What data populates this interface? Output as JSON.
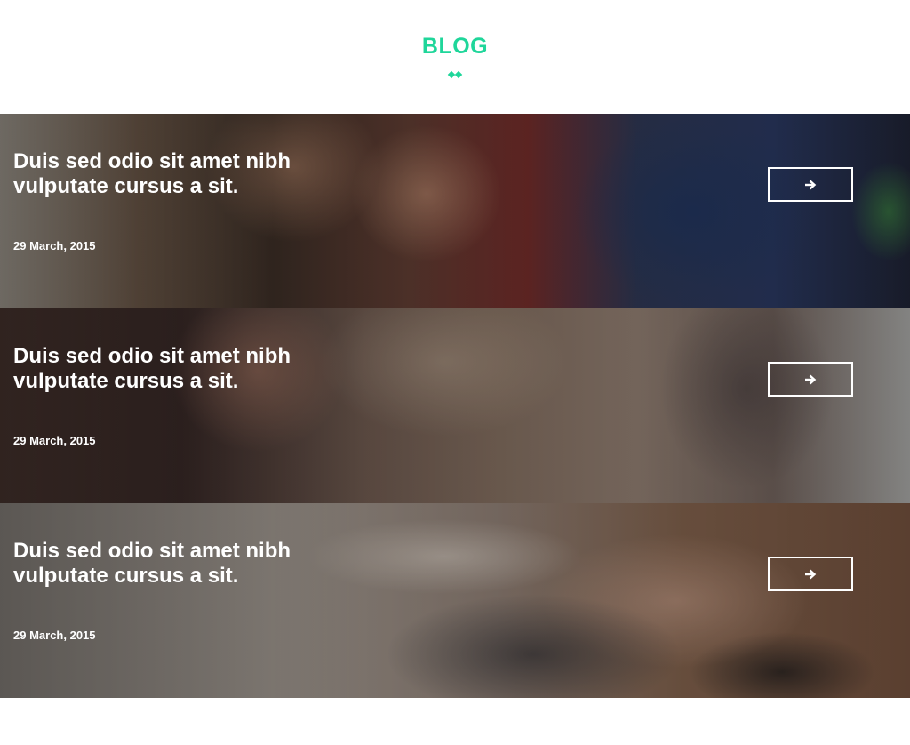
{
  "section": {
    "title": "BLOG",
    "accent_color": "#1fd69a",
    "divider_icon": "double-diamond-icon"
  },
  "posts": [
    {
      "title": "Duis sed odio sit amet nibh vulputate cursus a sit.",
      "date": "29 March, 2015",
      "button_icon": "arrow-right-icon"
    },
    {
      "title": "Duis sed odio sit amet nibh vulputate cursus a sit.",
      "date": "29 March, 2015",
      "button_icon": "arrow-right-icon"
    },
    {
      "title": "Duis sed odio sit amet nibh vulputate cursus a sit.",
      "date": "29 March, 2015",
      "button_icon": "arrow-right-icon"
    }
  ]
}
